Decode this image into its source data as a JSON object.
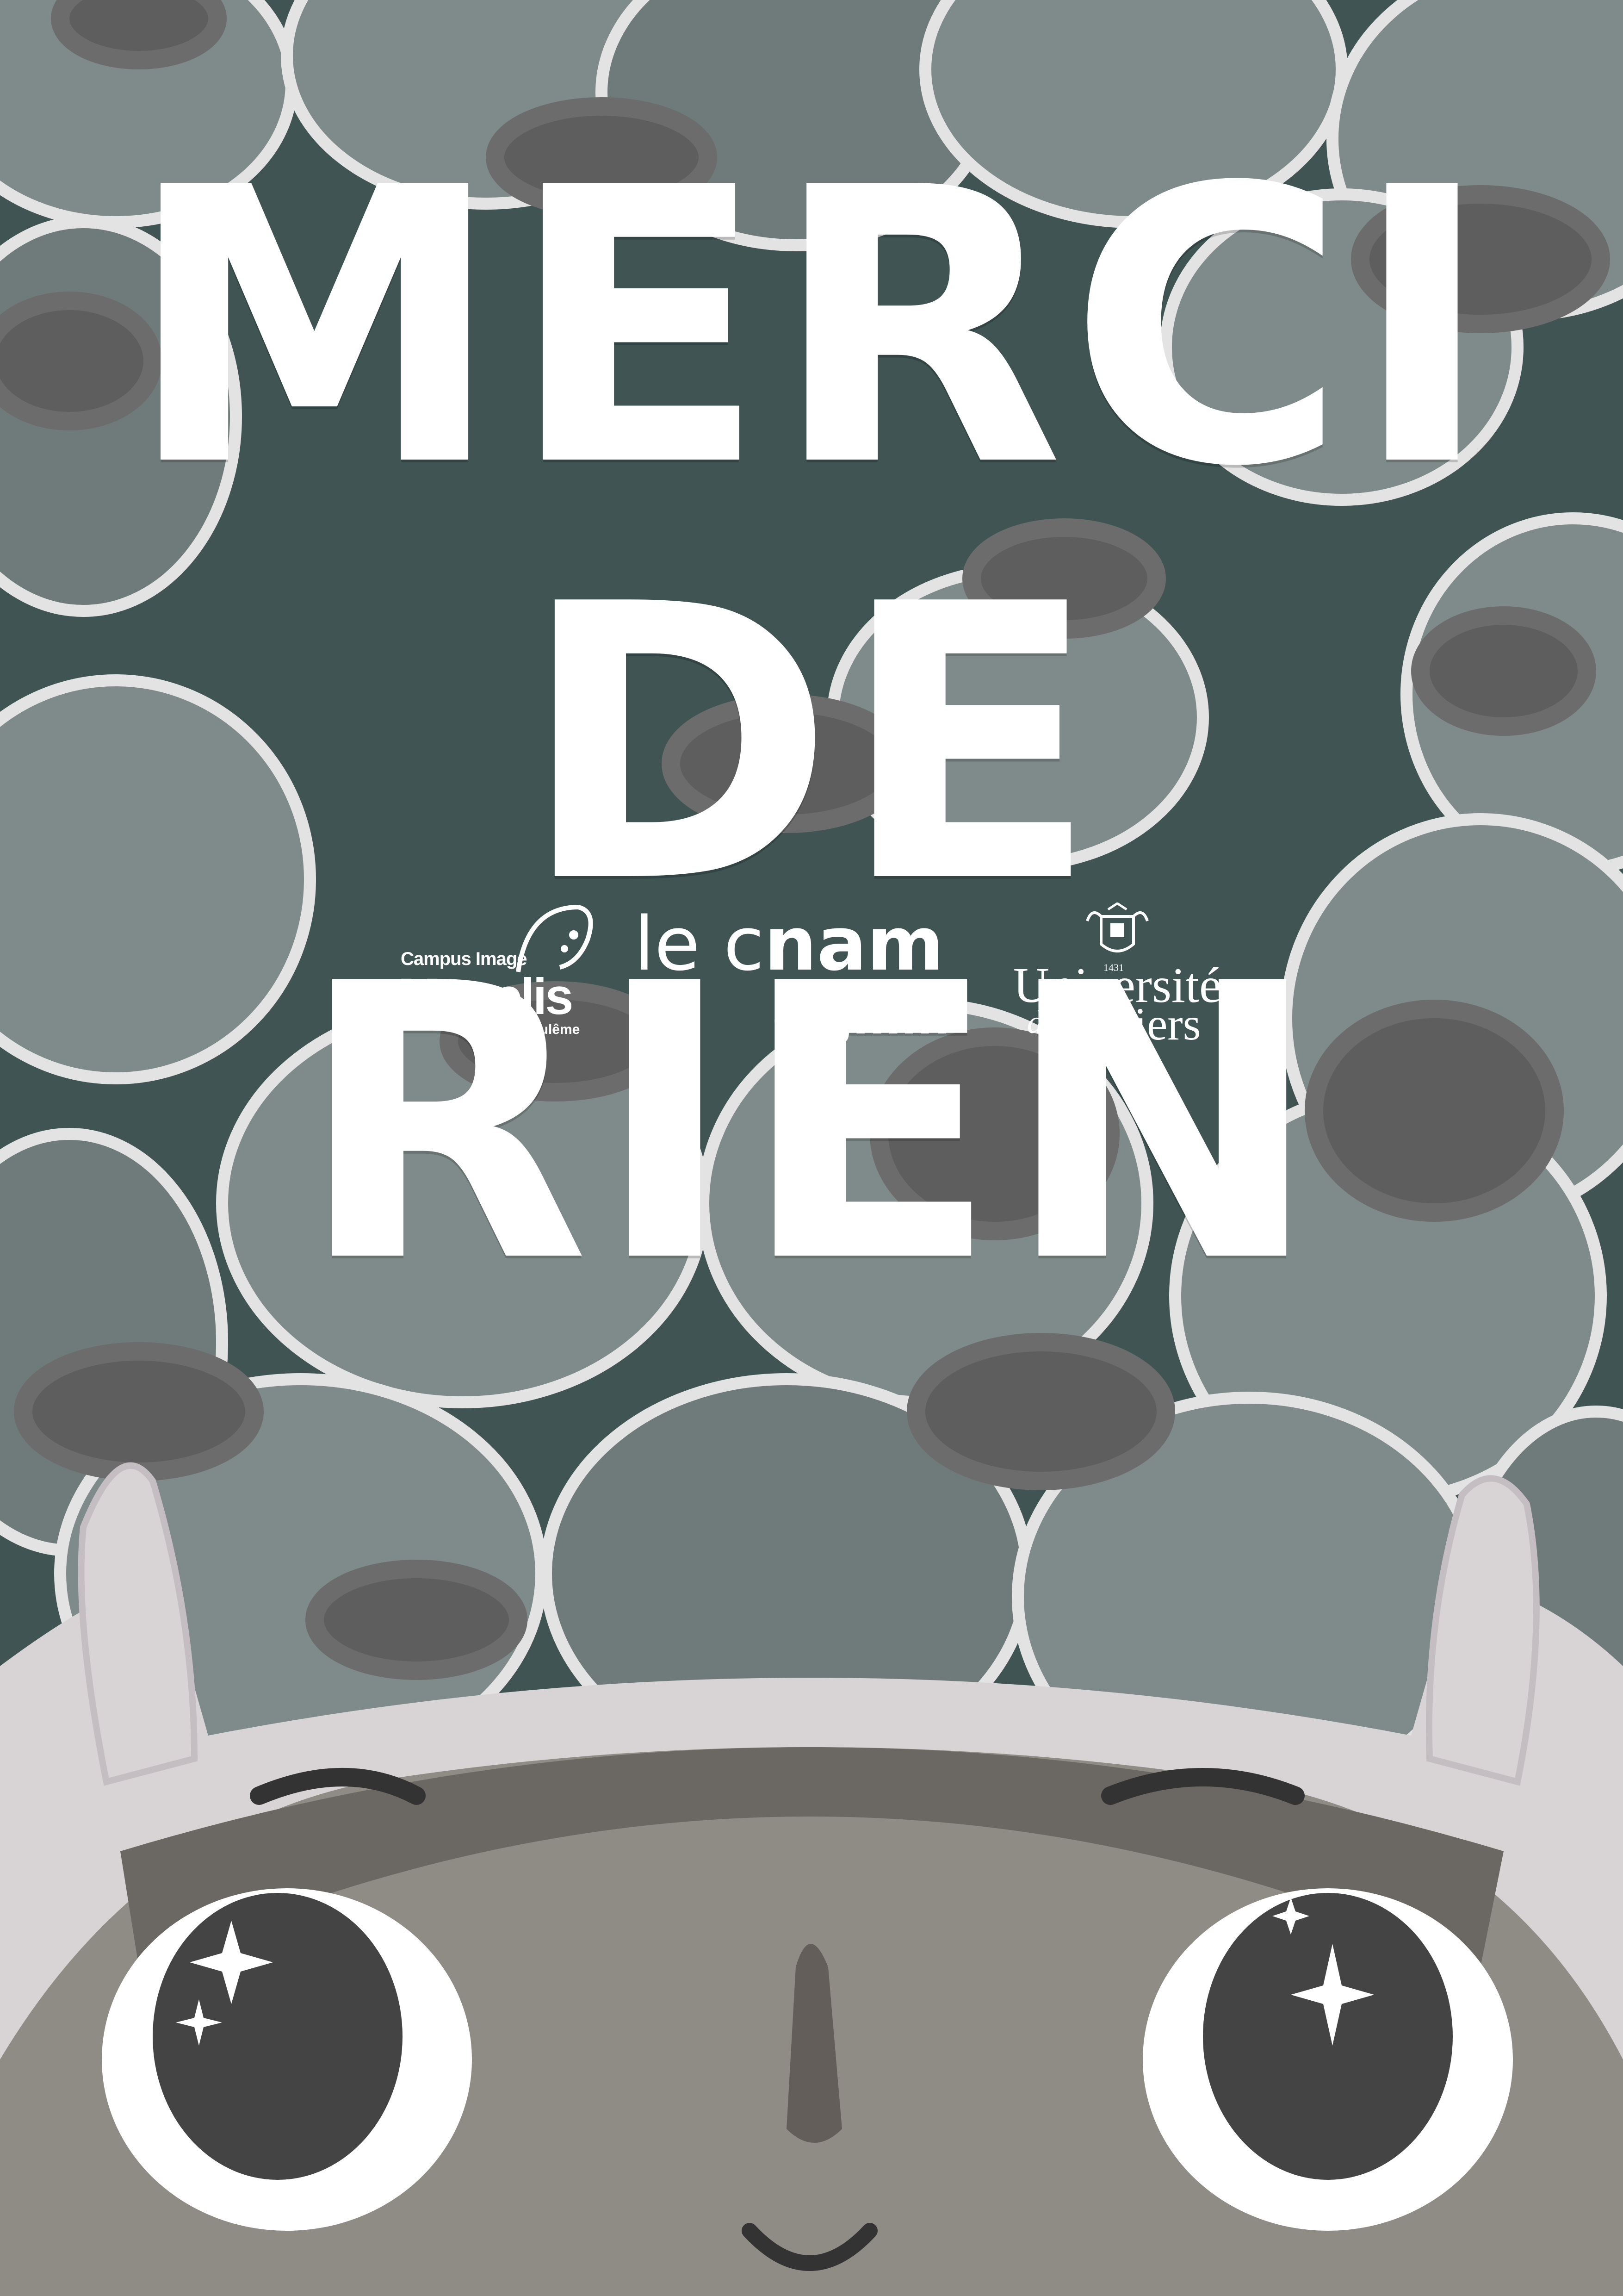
{
  "poster": {
    "title_line1": "MERCI",
    "title_line2": "DE RIEN"
  },
  "logos": {
    "magelis": {
      "line1": "Campus Image",
      "line2": "Magelis",
      "line3": "Angoulême"
    },
    "cnam": {
      "line1_light": "le c",
      "line1_bold": "nam",
      "line2": "enjmin"
    },
    "poitiers": {
      "year": "1431",
      "line1": "Université",
      "line2_italic": "de",
      "line2": "Poitiers"
    }
  },
  "colors": {
    "background": "#3f5453",
    "stone_light": "#7f8b8a",
    "stone_dark": "#5e5e5e",
    "highlight": "#e3e3e3",
    "character_face": "#8f8c85",
    "character_hair": "#d8d4d6",
    "eye_pupil": "#444444",
    "text": "#ffffff"
  }
}
